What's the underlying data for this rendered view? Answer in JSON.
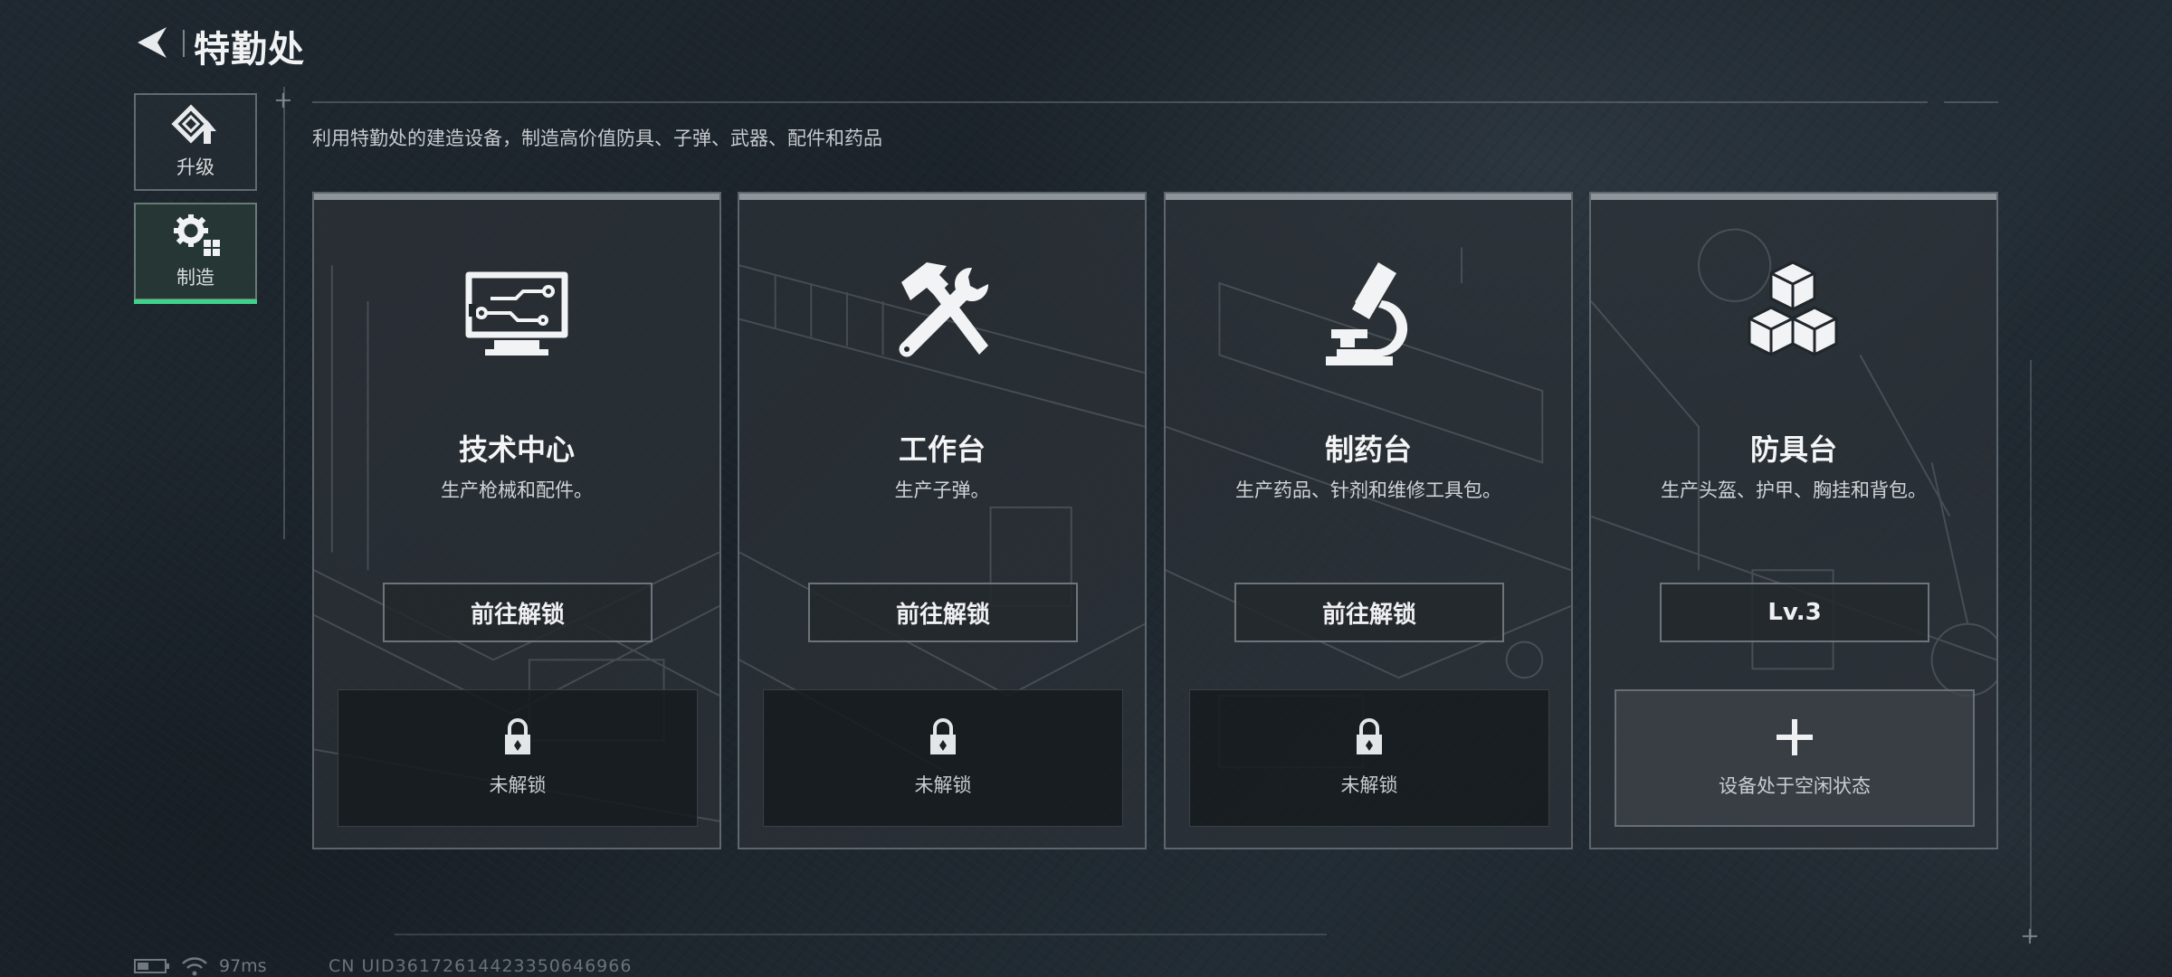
{
  "header": {
    "title": "特勤处"
  },
  "side_tabs": [
    {
      "label": "升级",
      "icon": "upgrade-icon"
    },
    {
      "label": "制造",
      "icon": "craft-gear-icon",
      "active": true
    }
  ],
  "description": "利用特勤处的建造设备，制造高价值防具、子弹、武器、配件和药品",
  "cards": [
    {
      "name": "技术中心",
      "sub": "生产枪械和配件。",
      "action": "前往解锁",
      "slot": "未解锁",
      "icon": "monitor-circuit-icon",
      "slot_icon": "lock-icon"
    },
    {
      "name": "工作台",
      "sub": "生产子弹。",
      "action": "前往解锁",
      "slot": "未解锁",
      "icon": "hammer-wrench-icon",
      "slot_icon": "lock-icon"
    },
    {
      "name": "制药台",
      "sub": "生产药品、针剂和维修工具包。",
      "action": "前往解锁",
      "slot": "未解锁",
      "icon": "microscope-icon",
      "slot_icon": "lock-icon"
    },
    {
      "name": "防具台",
      "sub": "生产头盔、护甲、胸挂和背包。",
      "action": "Lv.3",
      "slot": "设备处于空闲状态",
      "icon": "cubes-icon",
      "slot_icon": "plus-icon"
    }
  ],
  "status": {
    "ping": "97ms",
    "uid": "CN UID361726144233506​46966"
  },
  "colors": {
    "accent": "#3fd28a",
    "card_bg": "#2c3238",
    "text": "#e6e9ec"
  }
}
